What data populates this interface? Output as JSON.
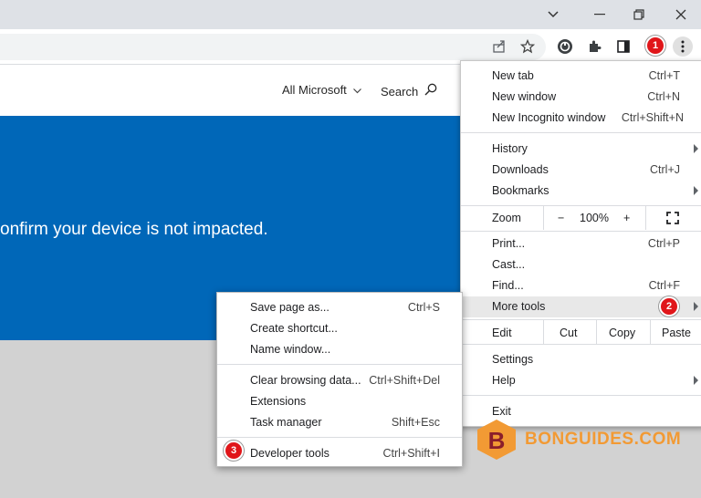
{
  "window": {
    "minimize_icon": "chevron-down-icon",
    "controls": [
      "minimize",
      "restore",
      "close"
    ]
  },
  "toolbar": {
    "icons": [
      "share-icon",
      "star-icon",
      "extension-circle-icon",
      "puzzle-icon",
      "side-panel-icon",
      "kebab-menu-icon"
    ]
  },
  "page": {
    "header_links": [
      "All Microsoft",
      "Search"
    ],
    "banner_text": "onfirm your device is not impacted.",
    "banner_color": "#0067b8"
  },
  "menu": {
    "new_tab": {
      "label": "New tab",
      "shortcut": "Ctrl+T"
    },
    "new_window": {
      "label": "New window",
      "shortcut": "Ctrl+N"
    },
    "new_incognito": {
      "label": "New Incognito window",
      "shortcut": "Ctrl+Shift+N"
    },
    "history": {
      "label": "History"
    },
    "downloads": {
      "label": "Downloads",
      "shortcut": "Ctrl+J"
    },
    "bookmarks": {
      "label": "Bookmarks"
    },
    "zoom": {
      "label": "Zoom",
      "minus": "−",
      "value": "100%",
      "plus": "+"
    },
    "print": {
      "label": "Print...",
      "shortcut": "Ctrl+P"
    },
    "cast": {
      "label": "Cast..."
    },
    "find": {
      "label": "Find...",
      "shortcut": "Ctrl+F"
    },
    "more_tools": {
      "label": "More tools"
    },
    "edit": {
      "label": "Edit",
      "cut": "Cut",
      "copy": "Copy",
      "paste": "Paste"
    },
    "settings": {
      "label": "Settings"
    },
    "help": {
      "label": "Help"
    },
    "exit": {
      "label": "Exit"
    }
  },
  "submenu": {
    "save_page": {
      "label": "Save page as...",
      "shortcut": "Ctrl+S"
    },
    "create_shortcut": {
      "label": "Create shortcut..."
    },
    "name_window": {
      "label": "Name window..."
    },
    "clear_browsing": {
      "label": "Clear browsing data...",
      "shortcut": "Ctrl+Shift+Del"
    },
    "extensions": {
      "label": "Extensions"
    },
    "task_manager": {
      "label": "Task manager",
      "shortcut": "Shift+Esc"
    },
    "developer_tools": {
      "label": "Developer tools",
      "shortcut": "Ctrl+Shift+I"
    }
  },
  "badges": [
    "1",
    "2",
    "3"
  ],
  "badge_color": "#e0161a",
  "watermark": {
    "letter": "B",
    "text": "BONGUIDES.COM",
    "color": "#f29a34"
  }
}
